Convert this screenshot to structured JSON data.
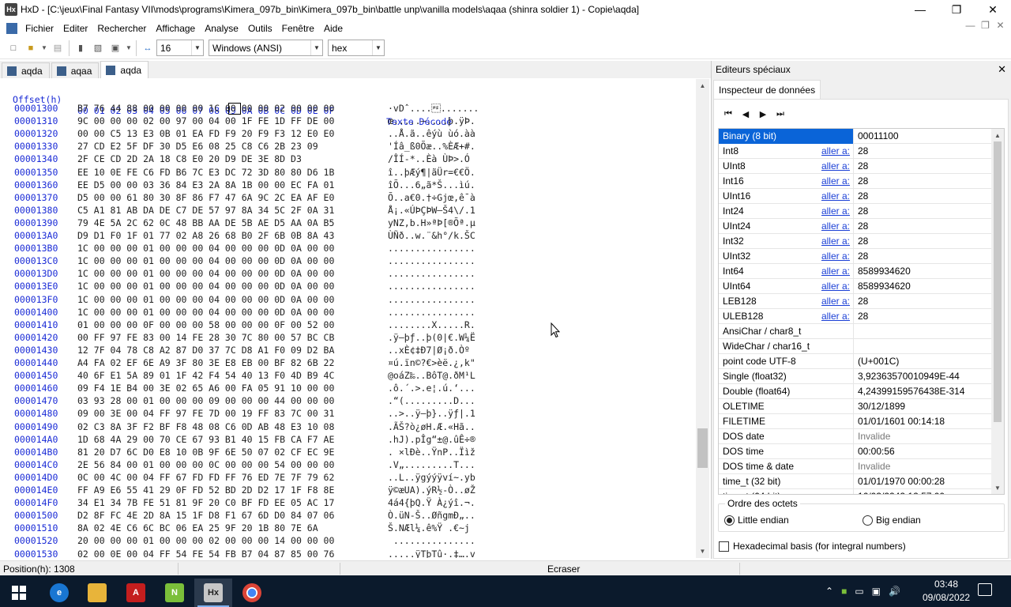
{
  "window": {
    "title": "HxD - [C:\\jeux\\Final Fantasy VII\\mods\\programs\\Kimera_097b_bin\\Kimera_097b_bin\\battle unp\\vanilla models\\aqaa (shinra soldier 1) - Copie\\aqda]",
    "icon": "hxd-app-icon"
  },
  "menu": [
    "Fichier",
    "Editer",
    "Rechercher",
    "Affichage",
    "Analyse",
    "Outils",
    "Fenêtre",
    "Aide"
  ],
  "toolbar": {
    "bytes_per_row": "16",
    "charset": "Windows (ANSI)",
    "offset_base": "hex"
  },
  "tabs": [
    {
      "label": "aqda",
      "active": false
    },
    {
      "label": "aqaa",
      "active": false
    },
    {
      "label": "aqda",
      "active": true
    }
  ],
  "hex": {
    "header_offset": "Offset(h)",
    "header_columns": "00 01 02 03 04 05 06 07 08 09 0A 0B 0C 0D 0E 0F",
    "header_text": "Texte Décodé",
    "rows": [
      {
        "offset": "00001300",
        "bytes": "B7 76 44 88 00 00 00 00 1C 00 00 00 02 00 00 00",
        "text": "·vDˆ....\u001c......."
      },
      {
        "offset": "00001310",
        "bytes": "9C 00 00 00 02 00 97 00 04 00 1F FE 1D FF DE 00",
        "text": "œ.....—....þ.ÿÞ."
      },
      {
        "offset": "00001320",
        "bytes": "00 00 C5 13 E3 0B 01 EA FD F9 20 F9 F3 12 E0 E0",
        "text": "..Å.ã..êýù ùó.àà"
      },
      {
        "offset": "00001330",
        "bytes": "27 CD E2 5F DF 30 D5 E6 08 25 C8 C6 2B 23 09",
        "text": "'Íâ_ß0Õæ..%ÈÆ+#."
      },
      {
        "offset": "00001340",
        "bytes": "2F CE CD 2D 2A 18 C8 E0 20 D9 DE 3E 8D D3",
        "text": "/ÎÍ-*..Èà ÙÞ>.Ó"
      },
      {
        "offset": "00001350",
        "bytes": "EE 10 0E FE C6 FD B6 7C E3 DC 72 3D 80 80 D6 1B",
        "text": "î..þÆý¶|ãÜr=€€Ö."
      },
      {
        "offset": "00001360",
        "bytes": "EE D5 00 00 03 36 84 E3 2A 8A 1B 00 00 EC FA 01",
        "text": "îÕ...6„ã*Š...ìú."
      },
      {
        "offset": "00001370",
        "bytes": "D5 00 00 61 80 30 8F 86 F7 47 6A 9C 2C EA AF E0",
        "text": "Õ..a€0.†÷Gjœ,ê¯à"
      },
      {
        "offset": "00001380",
        "bytes": "C5 A1 81 AB DA DE C7 DE 57 97 8A 34 5C 2F 0A 31",
        "text": "Å¡.«ÚÞÇÞW—Š4\\/.1"
      },
      {
        "offset": "00001390",
        "bytes": "79 4E 5A 2C 62 0C 48 BB AA DE 5B AE D5 AA 0A B5",
        "text": "yNZ,b.H»ªÞ[®Õª.µ"
      },
      {
        "offset": "000013A0",
        "bytes": "D9 D1 F0 1F 01 77 02 A8 26 68 B0 2F 6B 0B 8A 43",
        "text": "ÙÑð..w.¨&h°/k.ŠC"
      },
      {
        "offset": "000013B0",
        "bytes": "1C 00 00 00 01 00 00 00 04 00 00 00 0D 0A 00 00",
        "text": "................"
      },
      {
        "offset": "000013C0",
        "bytes": "1C 00 00 00 01 00 00 00 04 00 00 00 0D 0A 00 00",
        "text": "................"
      },
      {
        "offset": "000013D0",
        "bytes": "1C 00 00 00 01 00 00 00 04 00 00 00 0D 0A 00 00",
        "text": "................"
      },
      {
        "offset": "000013E0",
        "bytes": "1C 00 00 00 01 00 00 00 04 00 00 00 0D 0A 00 00",
        "text": "................"
      },
      {
        "offset": "000013F0",
        "bytes": "1C 00 00 00 01 00 00 00 04 00 00 00 0D 0A 00 00",
        "text": "................"
      },
      {
        "offset": "00001400",
        "bytes": "1C 00 00 00 01 00 00 00 04 00 00 00 0D 0A 00 00",
        "text": "................"
      },
      {
        "offset": "00001410",
        "bytes": "01 00 00 00 0F 00 00 00 58 00 00 00 0F 00 52 00",
        "text": "........X.....R."
      },
      {
        "offset": "00001420",
        "bytes": "00 FF 97 FE 83 00 14 FE 28 30 7C 80 00 57 BC CB",
        "text": ".ÿ—þƒ..þ(0|€.W¼Ë"
      },
      {
        "offset": "00001430",
        "bytes": "12 7F 04 78 C8 A2 87 D0 37 7C D8 A1 F0 09 D2 BA",
        "text": "..xÈ¢‡Ð7|Ø¡ð.Òº"
      },
      {
        "offset": "00001440",
        "bytes": "A4 FA 02 EF 6E A9 3F 80 3E E8 EB 00 BF 82 6B 22",
        "text": "¤ú.ïn©?€>èë.¿‚k\""
      },
      {
        "offset": "00001450",
        "bytes": "40 6F E1 5A 89 01 1F 42 F4 54 40 13 F0 4D B9 4C",
        "text": "@oáZ‰..BôT@.ðM¹L"
      },
      {
        "offset": "00001460",
        "bytes": "09 F4 1E B4 00 3E 02 65 A6 00 FA 05 91 10 00 00",
        "text": ".ô.´.>.e¦.ú.‘..."
      },
      {
        "offset": "00001470",
        "bytes": "03 93 28 00 01 00 00 00 09 00 00 00 44 00 00 00",
        "text": ".“(.........D..."
      },
      {
        "offset": "00001480",
        "bytes": "09 00 3E 00 04 FF 97 FE 7D 00 19 FF 83 7C 00 31",
        "text": "..>..ÿ—þ}..ÿƒ|.1"
      },
      {
        "offset": "00001490",
        "bytes": "02 C3 8A 3F F2 BF F8 48 08 C6 0D AB 48 E3 10 08",
        "text": ".ÃŠ?ò¿øH.Æ.«Hã.."
      },
      {
        "offset": "000014A0",
        "bytes": "1D 68 4A 29 00 70 CE 67 93 B1 40 15 FB CA F7 AE",
        "text": ".hJ).pÎg“±@.ûÊ÷®"
      },
      {
        "offset": "000014B0",
        "bytes": "81 20 D7 6C D0 E8 10 0B 9F 6E 50 07 02 CF EC 9E",
        "text": ". ×lÐè..ŸnP..Ïìž"
      },
      {
        "offset": "000014C0",
        "bytes": "2E 56 84 00 01 00 00 00 0C 00 00 00 54 00 00 00",
        "text": ".V„.........T..."
      },
      {
        "offset": "000014D0",
        "bytes": "0C 00 4C 00 04 FF 67 FD FD FF 76 ED 7E 7F 79 62",
        "text": "..L..ÿgýýÿví~.yb"
      },
      {
        "offset": "000014E0",
        "bytes": "FF A9 E6 55 41 29 0F FD 52 BD 2D D2 17 1F F8 8E",
        "text": "ÿ©æUA).ýR½-Ò..øŽ"
      },
      {
        "offset": "000014F0",
        "bytes": "34 E1 34 7B FE 51 81 9F 20 C0 BF FD EE 05 AC 17",
        "text": "4á4{þQ.Ÿ À¿ýî.¬."
      },
      {
        "offset": "00001500",
        "bytes": "D2 8F FC 4E 2D 8A 15 1F D8 F1 67 6D D0 84 07 06",
        "text": "Ò.üN-Š..ØñgmÐ„.."
      },
      {
        "offset": "00001510",
        "bytes": "8A 02 4E C6 6C BC 06 EA 25 9F 20 1B 80 7E 6A",
        "text": "Š.NÆl¼.ê%Ÿ .€~j"
      },
      {
        "offset": "00001520",
        "bytes": "20 00 00 00 01 00 00 00 02 00 00 00 14 00 00 00",
        "text": " ..............."
      },
      {
        "offset": "00001530",
        "bytes": "02 00 0E 00 04 FF 54 FE 54 FB B7 04 87 85 00 76",
        "text": ".....ÿTþTû·.‡….v"
      }
    ]
  },
  "side_panel": {
    "title": "Editeurs spéciaux",
    "tab": "Inspecteur de données",
    "link_label": "aller a:",
    "rows": [
      {
        "name": "Binary (8 bit)",
        "value": "00011100",
        "link": false,
        "selected": true
      },
      {
        "name": "Int8",
        "value": "28",
        "link": true
      },
      {
        "name": "UInt8",
        "value": "28",
        "link": true
      },
      {
        "name": "Int16",
        "value": "28",
        "link": true
      },
      {
        "name": "UInt16",
        "value": "28",
        "link": true
      },
      {
        "name": "Int24",
        "value": "28",
        "link": true
      },
      {
        "name": "UInt24",
        "value": "28",
        "link": true
      },
      {
        "name": "Int32",
        "value": "28",
        "link": true
      },
      {
        "name": "UInt32",
        "value": "28",
        "link": true
      },
      {
        "name": "Int64",
        "value": "8589934620",
        "link": true
      },
      {
        "name": "UInt64",
        "value": "8589934620",
        "link": true
      },
      {
        "name": "LEB128",
        "value": "28",
        "link": true
      },
      {
        "name": "ULEB128",
        "value": "28",
        "link": true
      },
      {
        "name": "AnsiChar / char8_t",
        "value": "",
        "link": false
      },
      {
        "name": "WideChar / char16_t",
        "value": "",
        "link": false
      },
      {
        "name": "point code UTF-8",
        "value": " (U+001C)",
        "link": false
      },
      {
        "name": "Single (float32)",
        "value": "3,92363570010949E-44",
        "link": false
      },
      {
        "name": "Double (float64)",
        "value": "4,24399159576438E-314",
        "link": false
      },
      {
        "name": "OLETIME",
        "value": "30/12/1899",
        "link": false
      },
      {
        "name": "FILETIME",
        "value": "01/01/1601 00:14:18",
        "link": false
      },
      {
        "name": "DOS date",
        "value": "Invalide",
        "link": false,
        "muted": true
      },
      {
        "name": "DOS time",
        "value": "00:00:56",
        "link": false
      },
      {
        "name": "DOS time & date",
        "value": "Invalide",
        "link": false,
        "muted": true
      },
      {
        "name": "time_t (32 bit)",
        "value": "01/01/1970 00:00:28",
        "link": false
      },
      {
        "name": "time_t (64 bit)",
        "value": "16/03/2242 12:57:00",
        "link": false
      }
    ],
    "byte_order_label": "Ordre des octets",
    "little_endian": "Little endian",
    "big_endian": "Big endian",
    "hex_basis_label": "Hexadecimal basis (for integral numbers)"
  },
  "status": {
    "position": "Position(h): 1308",
    "mode": "Ecraser"
  },
  "taskbar": {
    "apps": [
      "windows-start",
      "edge",
      "file-explorer",
      "acrobat",
      "notepad-plus",
      "hxd",
      "chrome"
    ],
    "time": "03:48",
    "date": "09/08/2022"
  },
  "colors": {
    "offset_blue": "#1a2bd6",
    "selection": "#0a64d8",
    "link": "#1a3fd6",
    "taskbar": "#0b1a2c"
  }
}
